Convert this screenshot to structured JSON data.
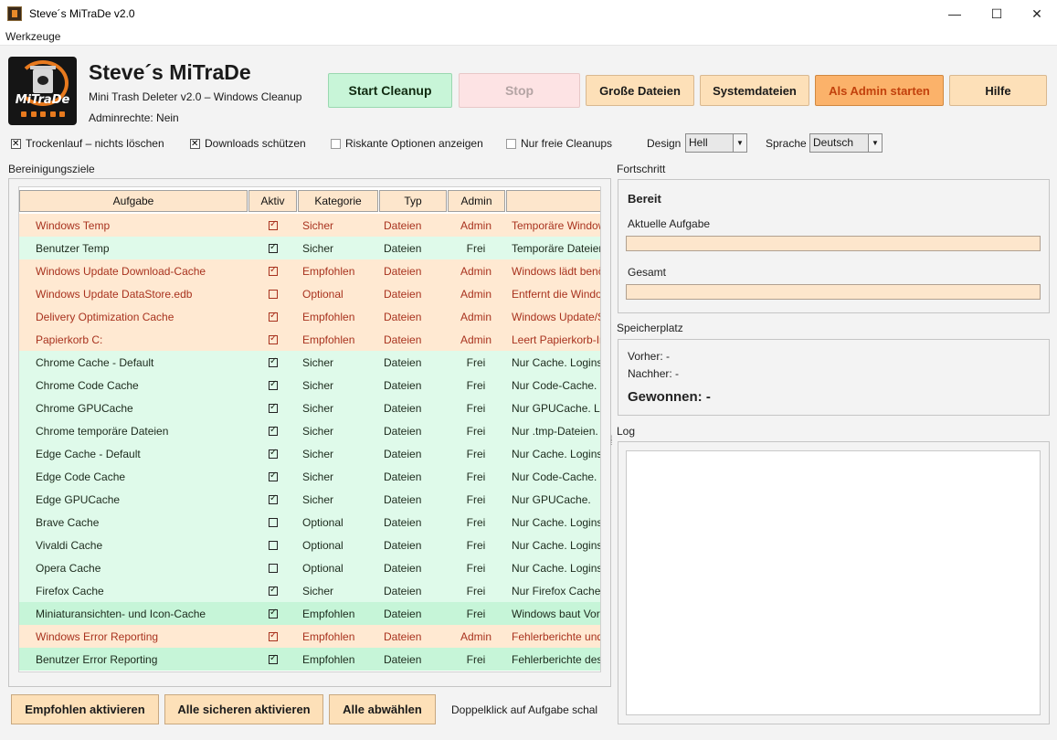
{
  "window": {
    "title": "Steve´s MiTraDe v2.0",
    "controls": {
      "minimize": "—",
      "maximize": "☐",
      "close": "✕"
    }
  },
  "menu": {
    "tools": "Werkzeuge"
  },
  "header": {
    "logo_text": "MiTraDe",
    "title": "Steve´s MiTraDe",
    "subtitle": "Mini Trash Deleter v2.0 – Windows Cleanup",
    "admin_status": "Adminrechte: Nein"
  },
  "toolbar": {
    "start": "Start Cleanup",
    "stop": "Stop",
    "large_files": "Große Dateien",
    "system_files": "Systemdateien",
    "run_as_admin": "Als Admin starten",
    "help": "Hilfe"
  },
  "options": {
    "dry_run": {
      "label": "Trockenlauf – nichts löschen",
      "checked": true
    },
    "protect_downloads": {
      "label": "Downloads schützen",
      "checked": true
    },
    "show_risky": {
      "label": "Riskante Optionen anzeigen",
      "checked": false
    },
    "free_only": {
      "label": "Nur freie Cleanups",
      "checked": false
    },
    "design_label": "Design",
    "design_value": "Hell",
    "language_label": "Sprache",
    "language_value": "Deutsch"
  },
  "targets": {
    "label": "Bereinigungsziele",
    "columns": [
      "Aufgabe",
      "Aktiv",
      "Kategorie",
      "Typ",
      "Admin",
      ""
    ],
    "rows": [
      {
        "task": "Windows Temp",
        "active": true,
        "category": "Sicher",
        "type": "Dateien",
        "admin": "Admin",
        "desc": "Temporäre Window",
        "style": "red"
      },
      {
        "task": "Benutzer Temp",
        "active": true,
        "category": "Sicher",
        "type": "Dateien",
        "admin": "Frei",
        "desc": "Temporäre Dateien",
        "style": "green"
      },
      {
        "task": "Windows Update Download-Cache",
        "active": true,
        "category": "Empfohlen",
        "type": "Dateien",
        "admin": "Admin",
        "desc": "Windows lädt benö",
        "style": "red"
      },
      {
        "task": "Windows Update DataStore.edb",
        "active": false,
        "category": "Optional",
        "type": "Dateien",
        "admin": "Admin",
        "desc": "Entfernt die Windo",
        "style": "red"
      },
      {
        "task": "Delivery Optimization Cache",
        "active": true,
        "category": "Empfohlen",
        "type": "Dateien",
        "admin": "Admin",
        "desc": "Windows Update/S",
        "style": "red"
      },
      {
        "task": "Papierkorb C:",
        "active": true,
        "category": "Empfohlen",
        "type": "Dateien",
        "admin": "Admin",
        "desc": "Leert Papierkorb-In",
        "style": "red"
      },
      {
        "task": "Chrome Cache - Default",
        "active": true,
        "category": "Sicher",
        "type": "Dateien",
        "admin": "Frei",
        "desc": "Nur Cache. Logins,",
        "style": "green"
      },
      {
        "task": "Chrome Code Cache",
        "active": true,
        "category": "Sicher",
        "type": "Dateien",
        "admin": "Frei",
        "desc": "Nur Code-Cache. L",
        "style": "green"
      },
      {
        "task": "Chrome GPUCache",
        "active": true,
        "category": "Sicher",
        "type": "Dateien",
        "admin": "Frei",
        "desc": "Nur GPUCache. Lo",
        "style": "green"
      },
      {
        "task": "Chrome temporäre Dateien",
        "active": true,
        "category": "Sicher",
        "type": "Dateien",
        "admin": "Frei",
        "desc": "Nur .tmp-Dateien.",
        "style": "green"
      },
      {
        "task": "Edge Cache - Default",
        "active": true,
        "category": "Sicher",
        "type": "Dateien",
        "admin": "Frei",
        "desc": "Nur Cache. Logins,",
        "style": "green"
      },
      {
        "task": "Edge Code Cache",
        "active": true,
        "category": "Sicher",
        "type": "Dateien",
        "admin": "Frei",
        "desc": "Nur Code-Cache.",
        "style": "green"
      },
      {
        "task": "Edge GPUCache",
        "active": true,
        "category": "Sicher",
        "type": "Dateien",
        "admin": "Frei",
        "desc": "Nur GPUCache.",
        "style": "green"
      },
      {
        "task": "Brave Cache",
        "active": false,
        "category": "Optional",
        "type": "Dateien",
        "admin": "Frei",
        "desc": "Nur Cache. Logins,",
        "style": "green"
      },
      {
        "task": "Vivaldi Cache",
        "active": false,
        "category": "Optional",
        "type": "Dateien",
        "admin": "Frei",
        "desc": "Nur Cache. Logins,",
        "style": "green"
      },
      {
        "task": "Opera Cache",
        "active": false,
        "category": "Optional",
        "type": "Dateien",
        "admin": "Frei",
        "desc": "Nur Cache. Logins,",
        "style": "green"
      },
      {
        "task": "Firefox Cache",
        "active": true,
        "category": "Sicher",
        "type": "Dateien",
        "admin": "Frei",
        "desc": "Nur Firefox Cache-",
        "style": "green"
      },
      {
        "task": "Miniaturansichten- und Icon-Cache",
        "active": true,
        "category": "Empfohlen",
        "type": "Dateien",
        "admin": "Frei",
        "desc": "Windows baut Vors",
        "style": "green2"
      },
      {
        "task": "Windows Error Reporting",
        "active": true,
        "category": "Empfohlen",
        "type": "Dateien",
        "admin": "Admin",
        "desc": "Fehlerberichte und",
        "style": "red"
      },
      {
        "task": "Benutzer Error Reporting",
        "active": true,
        "category": "Empfohlen",
        "type": "Dateien",
        "admin": "Frei",
        "desc": "Fehlerberichte des",
        "style": "green2"
      }
    ]
  },
  "bottom": {
    "enable_recommended": "Empfohlen aktivieren",
    "enable_safe": "Alle sicheren aktivieren",
    "deselect_all": "Alle abwählen",
    "hint": "Doppelklick auf Aufgabe schal"
  },
  "progress": {
    "label": "Fortschritt",
    "status": "Bereit",
    "current_label": "Aktuelle Aufgabe",
    "current_value": 0,
    "total_label": "Gesamt",
    "total_value": 0
  },
  "storage": {
    "label": "Speicherplatz",
    "before": "Vorher: -",
    "after": "Nachher: -",
    "gained": "Gewonnen: -"
  },
  "log": {
    "label": "Log"
  },
  "colors": {
    "accent_orange": "#fbb26a",
    "row_admin_bg": "#ffe9d2",
    "row_free_bg": "#dffaea",
    "start_green": "#c8f5d8"
  }
}
